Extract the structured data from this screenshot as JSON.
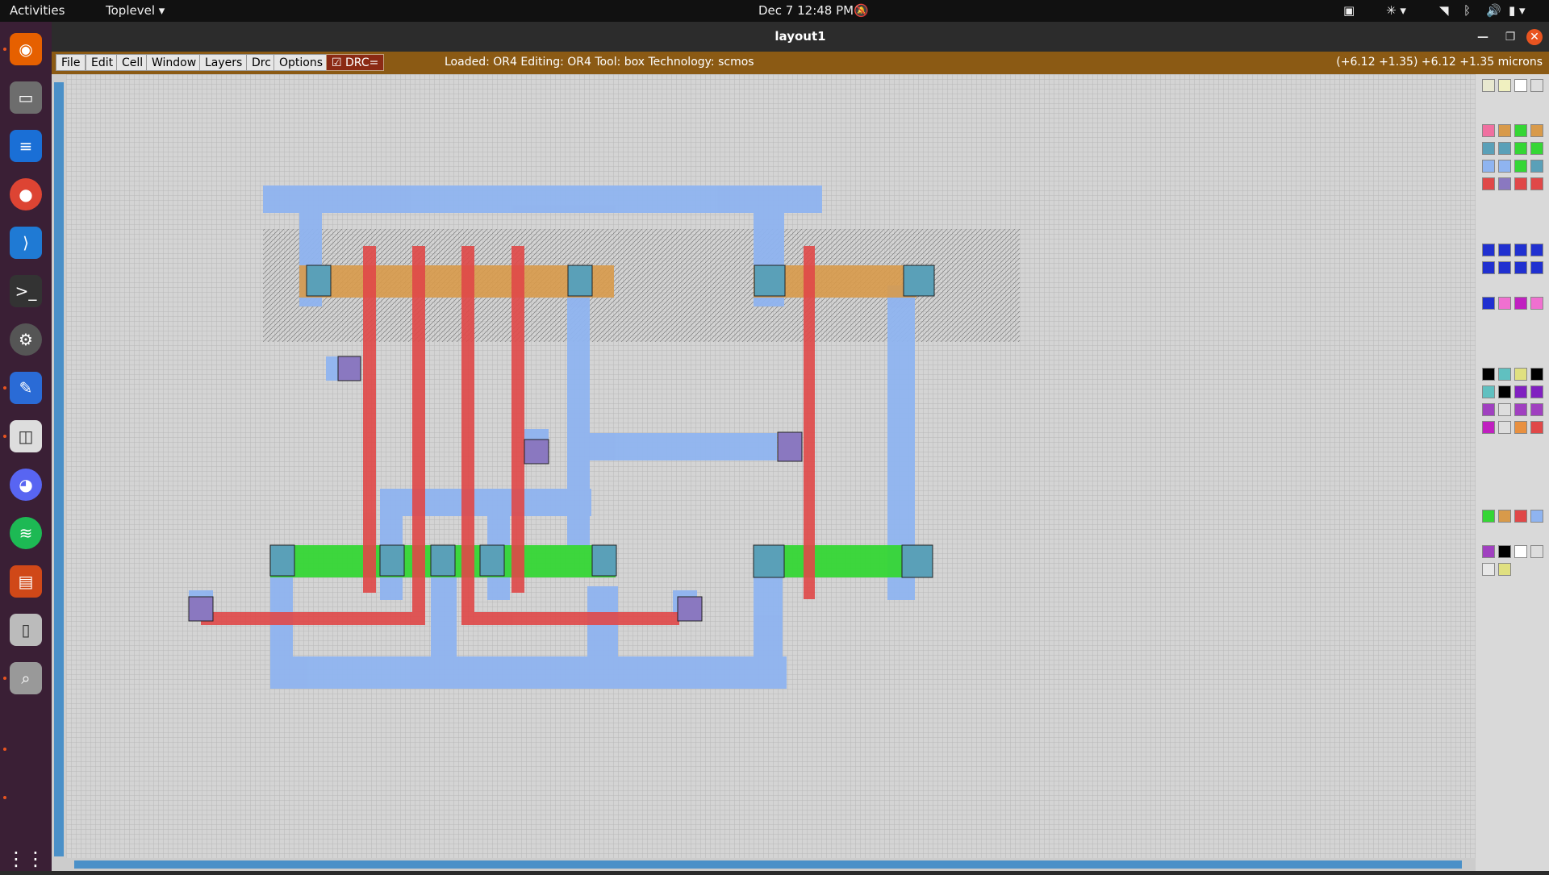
{
  "topbar": {
    "activities": "Activities",
    "app_menu": "Toplevel",
    "datetime": "Dec 7  12:48 PM"
  },
  "window": {
    "title": "layout1"
  },
  "menubar": {
    "items": [
      "File",
      "Edit",
      "Cell",
      "Window",
      "Layers",
      "Drc",
      "Options"
    ],
    "drc_label": "DRC=",
    "status": "Loaded: OR4  Editing: OR4  Tool: box   Technology: scmos",
    "coords": "(+6.12 +1.35) +6.12 +1.35 microns"
  },
  "dock": {
    "apps": [
      "firefox-icon",
      "files-icon",
      "writer-icon",
      "chrome-icon",
      "vscode-icon",
      "terminal-icon",
      "settings-icon",
      "editor-icon",
      "reader-icon",
      "discord-icon",
      "spotify-icon",
      "impress-icon",
      "usb-icon",
      "magnifier-icon"
    ]
  },
  "colors": {
    "metal1": "#8fb4f0",
    "poly": "#e04848",
    "ndiff": "#35d635",
    "pdiff": "#d89a4a",
    "contact": "#5aa0b8",
    "menubar": "#8b5a14"
  }
}
